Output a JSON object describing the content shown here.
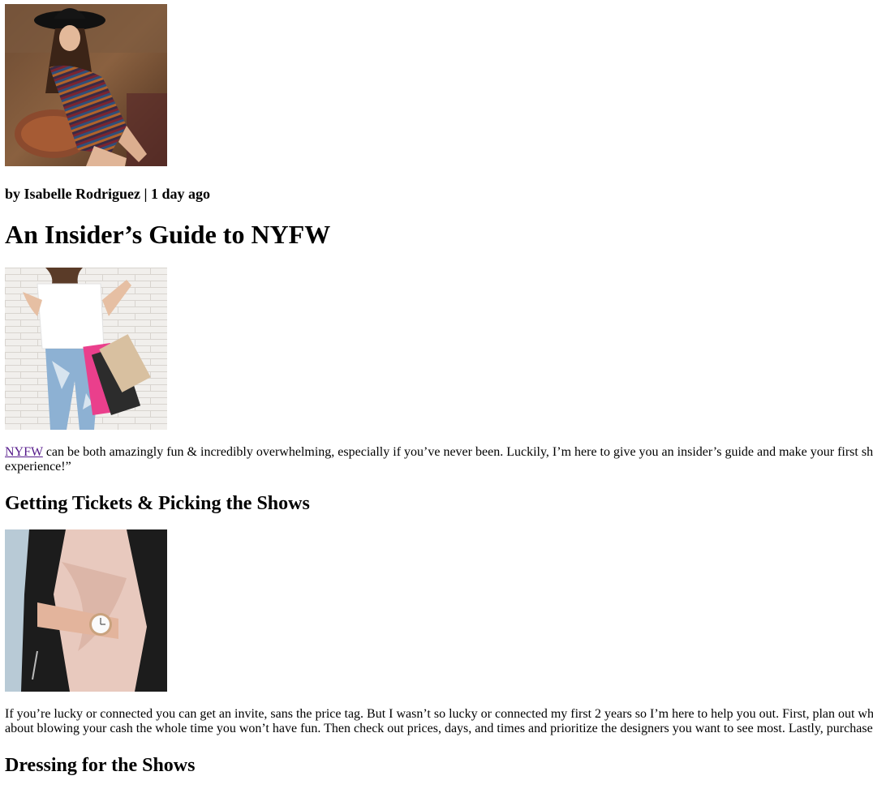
{
  "article": {
    "byline": "by Isabelle Rodriguez | 1 day ago",
    "title": "An Insider’s Guide to NYFW",
    "intro": {
      "link_text": "NYFW",
      "text_line1": " can be both amazingly fun & incredibly overwhelming, especially if you’ve never been. Luckily, I’m here to give you an insider’s guide and make your first sh",
      "text_line2": "experience!”"
    },
    "sections": [
      {
        "heading": "Getting Tickets & Picking the Shows",
        "line1": "If you’re lucky or connected you can get an invite, sans the price tag. But I wasn’t so lucky or connected my first 2 years so I’m here to help you out. First, plan out wh",
        "line2": "about blowing your cash the whole time you won’t have fun. Then check out prices, days, and times and prioritize the designers you want to see most. Lastly, purchase"
      },
      {
        "heading": "Dressing for the Shows"
      }
    ]
  },
  "images": {
    "hero": "woman-in-hat-striped-dress-photo",
    "shopping": "woman-with-shopping-bags-photo",
    "jacket": "leather-jacket-watch-photo",
    "dressing": "fashion-photo"
  }
}
